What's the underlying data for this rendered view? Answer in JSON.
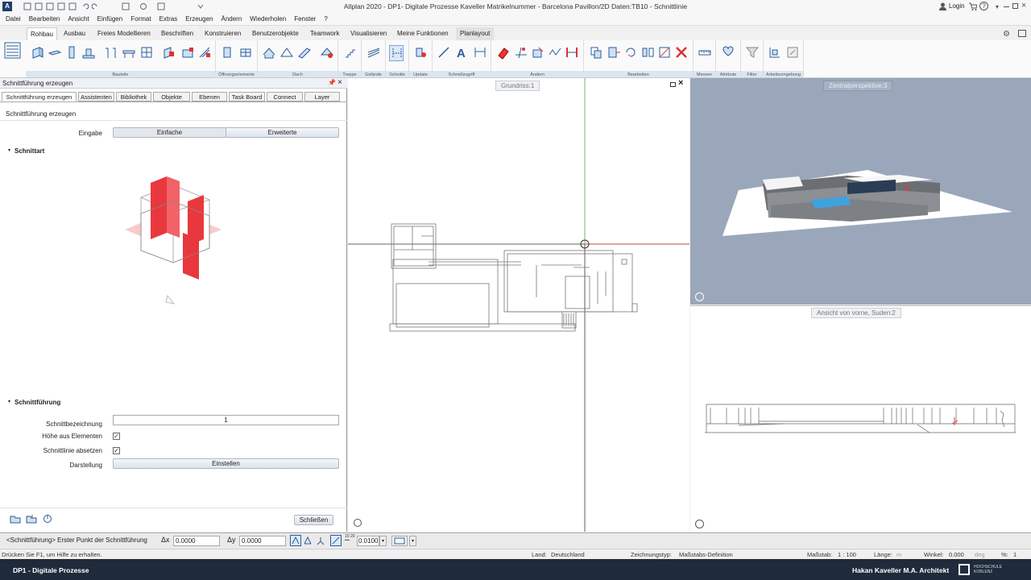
{
  "app": {
    "title": "Allplan 2020 - DP1- Digitale Prozesse Kaveller Matrikelnummer - Barcelona Pavillon/2D Daten:TB10 - Schnittlinie",
    "login_label": "Login"
  },
  "menu": [
    "Datei",
    "Bearbeiten",
    "Ansicht",
    "Einfügen",
    "Format",
    "Extras",
    "Erzeugen",
    "Ändern",
    "Wiederholen",
    "Fenster",
    "?"
  ],
  "ribbon_tabs": [
    "Rohbau",
    "Ausbau",
    "Freies Modellieren",
    "Beschriften",
    "Konstruieren",
    "Benutzerobjekte",
    "Teamwork",
    "Visualisieren",
    "Meine Funktionen",
    "Planlayout"
  ],
  "ribbon_groups": [
    "Bauteile",
    "Öffnungselemente",
    "Dach",
    "Treppe",
    "Gelände",
    "Schnitte",
    "Update",
    "Schnellzugriff",
    "Ändern",
    "Bearbeiten",
    "Messen",
    "Attribute",
    "Filter",
    "Arbeitsumgebung"
  ],
  "panel": {
    "title": "Schnittführung erzeugen",
    "tabs": [
      "Schnittführung erzeugen",
      "Assistenten",
      "Bibliothek",
      "Objekte",
      "Ebenen",
      "Task Board",
      "Connect",
      "Layer"
    ],
    "subtitle": "Schnittführung erzeugen",
    "eingabe_label": "Eingabe",
    "eingabe_options": [
      "Einfache",
      "Erweiterte"
    ],
    "section_schnittart": "Schnittart",
    "section_schnittfuehrung": "Schnittführung",
    "schnittbezeichnung_label": "Schnittbezeichnung",
    "schnittbezeichnung_value": "1",
    "hoehe_label": "Höhe aus Elementen",
    "schnittlinie_label": "Schnittlinie absetzen",
    "darstellung_label": "Darstellung",
    "einstellen_label": "Einstellen",
    "schliessen_label": "Schließen"
  },
  "viewports": {
    "grundriss": "Grundriss:1",
    "perspektive": "Zentralperspektive:3",
    "ansicht": "Ansicht von vorne, Suden:2"
  },
  "command_line": {
    "prompt": "<Schnittführung> Erster Punkt der Schnittführung",
    "dx_label": "Δx",
    "dx_value": "0.0000",
    "dy_label": "Δy",
    "dy_value": "0.0000",
    "step_value": "0.0100"
  },
  "status": {
    "help": "Drücken Sie F1, um Hilfe zu erhalten.",
    "land_label": "Land:",
    "land_value": "Deutschland",
    "zeichnungstyp_label": "Zeichnungstyp:",
    "zeichnungstyp_value": "Maßstabs-Definition",
    "massstab_label": "Maßstab:",
    "massstab_value": "1 : 100",
    "laenge_label": "Länge:",
    "laenge_unit": "m",
    "winkel_label": "Winkel:",
    "winkel_value": "0.000",
    "winkel_unit": "deg",
    "percent_label": "%:",
    "percent_value": "1"
  },
  "footer": {
    "left": "DP1 - Digitale Prozesse",
    "right": "Hakan Kaveller M.A. Architekt",
    "logo_text": "HOCHSCHULE KOBLENZ"
  },
  "colors": {
    "accent": "#1a6fc4",
    "footer_bg": "#1f2b3b",
    "cut_red": "#e8383d",
    "persp_bg": "#9aa7ba"
  }
}
